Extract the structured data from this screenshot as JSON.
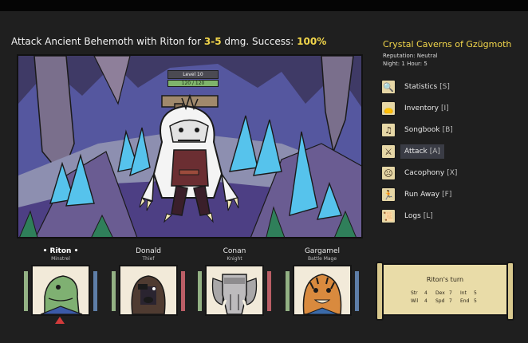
{
  "action": {
    "prefix": "Attack Ancient Behemoth with Riton for",
    "damage": "3-5",
    "middle": "dmg. Success:",
    "success": "100%"
  },
  "enemy": {
    "level_label": "Level 10",
    "hp_text": "120 / 120",
    "hp_fraction": 1.0
  },
  "location": {
    "title": "Crystal Caverns of Gzügmoth",
    "reputation": "Reputation: Neutral",
    "time": "Night: 1   Hour: 5"
  },
  "menu": [
    {
      "label": "Statistics",
      "key": "[S]",
      "icon": "magnifier-icon",
      "glyph": "🔍",
      "active": false
    },
    {
      "label": "Inventory",
      "key": "[I]",
      "icon": "bag-icon",
      "glyph": "👝",
      "active": false
    },
    {
      "label": "Songbook",
      "key": "[B]",
      "icon": "music-book-icon",
      "glyph": "♫",
      "active": false
    },
    {
      "label": "Attack",
      "key": "[A]",
      "icon": "sword-icon",
      "glyph": "⚔",
      "active": true
    },
    {
      "label": "Cacophony",
      "key": "[X]",
      "icon": "cacophony-face-icon",
      "glyph": "☹",
      "active": false
    },
    {
      "label": "Run Away",
      "key": "[F]",
      "icon": "running-man-icon",
      "glyph": "🏃",
      "active": false
    },
    {
      "label": "Logs",
      "key": "[L]",
      "icon": "scroll-icon",
      "glyph": "📜",
      "active": false
    }
  ],
  "party": [
    {
      "name": "• Riton •",
      "class": "Minstrel",
      "selected": true,
      "mp_color": "#5e7ea8"
    },
    {
      "name": "Donald",
      "class": "Thief",
      "selected": false,
      "mp_color": "#bb5e66"
    },
    {
      "name": "Conan",
      "class": "Knight",
      "selected": false,
      "mp_color": "#bb5e66"
    },
    {
      "name": "Gargamel",
      "class": "Battle Mage",
      "selected": false,
      "mp_color": "#5e7ea8"
    }
  ],
  "turn": {
    "title": "Riton's turn",
    "stats": [
      [
        {
          "k": "Str",
          "v": "4"
        },
        {
          "k": "Dex",
          "v": "7"
        },
        {
          "k": "Int",
          "v": "5"
        }
      ],
      [
        {
          "k": "Wil",
          "v": "4"
        },
        {
          "k": "Spd",
          "v": "7"
        },
        {
          "k": "End",
          "v": "5"
        }
      ]
    ]
  },
  "colors": {
    "accent_yellow": "#f2d64b",
    "background": "#1f1f1f",
    "hp_green": "#7fb46b"
  }
}
